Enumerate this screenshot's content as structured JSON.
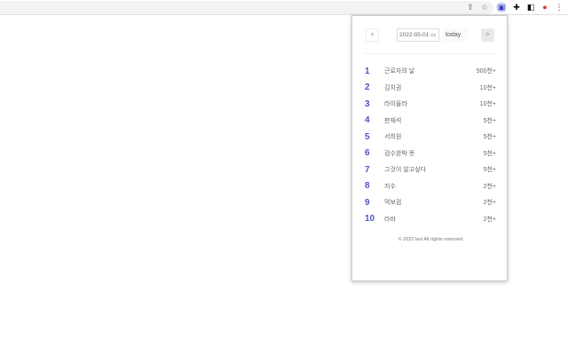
{
  "browser": {
    "icons": [
      "share-icon",
      "star-icon",
      "extension-active-icon",
      "puzzle-icon",
      "sidebar-icon",
      "profile-icon",
      "menu-icon"
    ]
  },
  "popup": {
    "prev_label": "<",
    "next_label": ">",
    "date_value": "2022-05-01",
    "today_label": "today",
    "items": [
      {
        "rank": "1",
        "keyword": "근로자의 날",
        "count": "500천+"
      },
      {
        "rank": "2",
        "keyword": "김치권",
        "count": "10천+"
      },
      {
        "rank": "3",
        "keyword": "라이올라",
        "count": "10천+"
      },
      {
        "rank": "4",
        "keyword": "판재석",
        "count": "5천+"
      },
      {
        "rank": "5",
        "keyword": "서희원",
        "count": "5천+"
      },
      {
        "rank": "6",
        "keyword": "검수완박 뜻",
        "count": "5천+"
      },
      {
        "rank": "7",
        "keyword": "그것이 알고싶다",
        "count": "5천+"
      },
      {
        "rank": "8",
        "keyword": "지수",
        "count": "2천+"
      },
      {
        "rank": "9",
        "keyword": "먹보검",
        "count": "2천+"
      },
      {
        "rank": "10",
        "keyword": "라바",
        "count": "2천+"
      }
    ],
    "footer": "© 2022 lavi All rights reserved"
  }
}
